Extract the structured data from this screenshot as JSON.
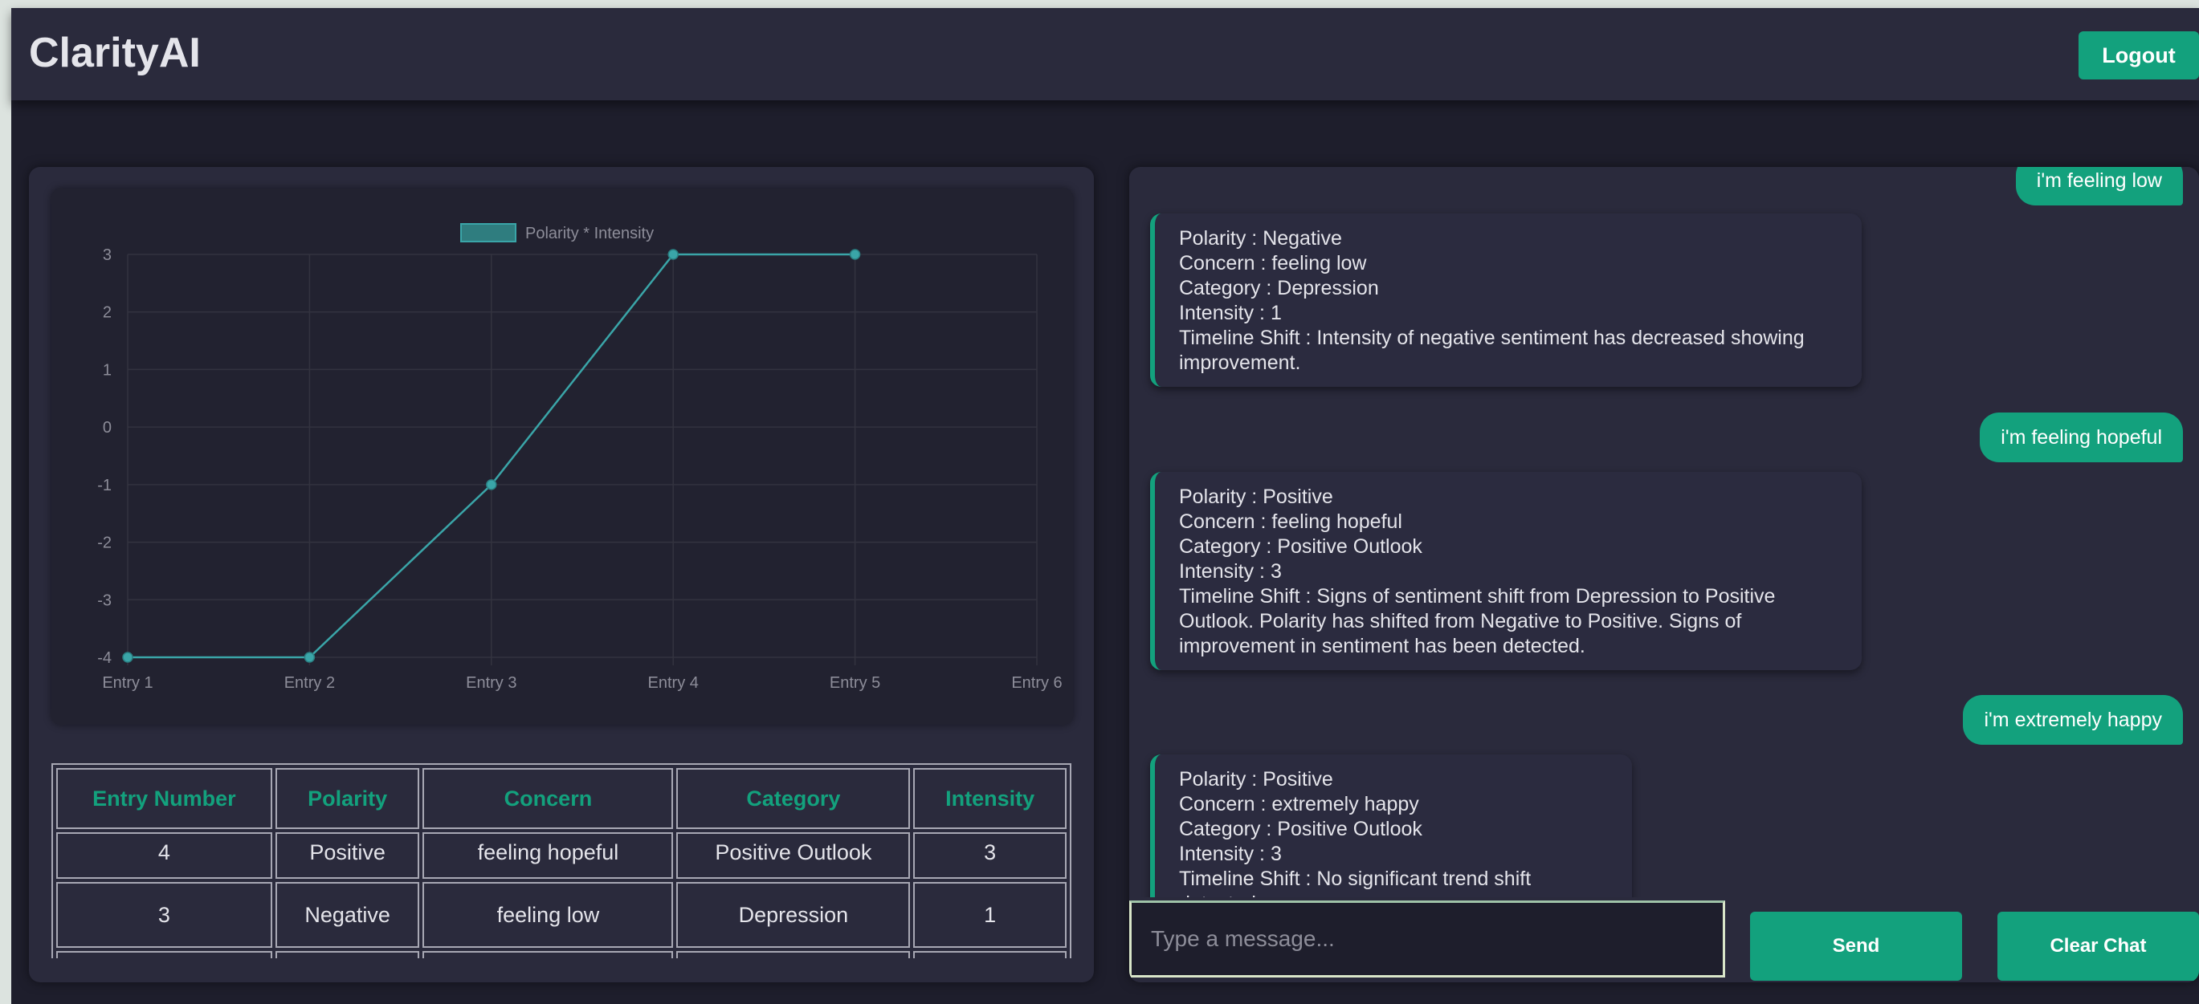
{
  "header": {
    "brand": "ClarityAI",
    "logout_label": "Logout"
  },
  "colors": {
    "accent": "#13a17d",
    "background": "#1e1e2c",
    "panel": "#2a2a3c"
  },
  "chart_data": {
    "type": "line",
    "categories": [
      "Entry 1",
      "Entry 2",
      "Entry 3",
      "Entry 4",
      "Entry 5",
      "Entry 6"
    ],
    "series": [
      {
        "name": "Polarity * Intensity",
        "values": [
          -4,
          -4,
          -1,
          3,
          3,
          null
        ]
      }
    ],
    "yticks": [
      "3",
      "2",
      "1",
      "0",
      "-1",
      "-2",
      "-3",
      "-4"
    ],
    "ylim": [
      -4,
      3
    ],
    "grid": true,
    "legend": "top-center"
  },
  "table": {
    "headers": [
      "Entry Number",
      "Polarity",
      "Concern",
      "Category",
      "Intensity"
    ],
    "rows": [
      [
        "4",
        "Positive",
        "feeling hopeful",
        "Positive Outlook",
        "3"
      ],
      [
        "3",
        "Negative",
        "feeling low",
        "Depression",
        "1"
      ]
    ]
  },
  "chat": {
    "user_messages": [
      "i'm feeling low",
      "i'm feeling hopeful",
      "i'm extremely happy"
    ],
    "bot_messages": [
      [
        "Polarity : Negative",
        "Concern : feeling low",
        "Category : Depression",
        "Intensity : 1",
        "Timeline Shift : Intensity of negative sentiment has decreased showing improvement."
      ],
      [
        "Polarity : Positive",
        "Concern : feeling hopeful",
        "Category : Positive Outlook",
        "Intensity : 3",
        "Timeline Shift : Signs of sentiment shift from Depression to Positive Outlook. Polarity has shifted from Negative to Positive. Signs of improvement in sentiment has been detected."
      ],
      [
        "Polarity : Positive",
        "Concern : extremely happy",
        "Category : Positive Outlook",
        "Intensity : 3",
        "Timeline Shift : No significant trend shift detected."
      ]
    ],
    "input_placeholder": "Type a message...",
    "send_label": "Send",
    "clear_label": "Clear Chat"
  }
}
